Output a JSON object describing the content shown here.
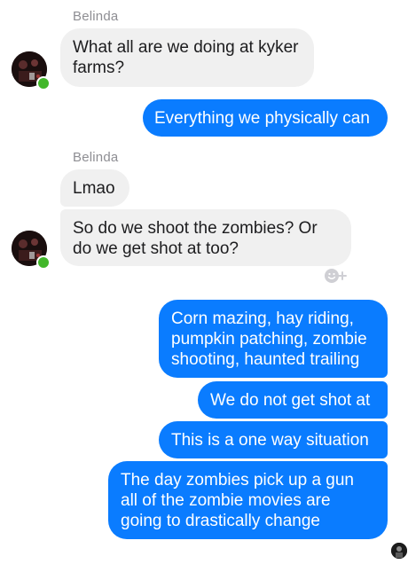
{
  "thread": {
    "groups": [
      {
        "sender": "Belinda",
        "messages": [
          "What all are we doing at kyker\nfarms?"
        ]
      },
      {
        "sender": "",
        "messages": [
          "Everything we physically can"
        ]
      },
      {
        "sender": "Belinda",
        "messages": [
          "Lmao",
          "So do we shoot the zombies? Or\ndo we get shot at too?"
        ]
      },
      {
        "sender": "",
        "messages": [
          "Corn mazing, hay riding,\npumpkin patching, zombie\nshooting, haunted trailing",
          "We do not get shot at",
          "This is a one way situation",
          "The day zombies pick up a gun\nall of the zombie movies are\ngoing to drastically change"
        ]
      }
    ]
  },
  "colors": {
    "outgoing_bubble": "#0a7cff",
    "incoming_bubble": "#f0f0f0",
    "online_indicator": "#42b72a",
    "sender_name": "#8e8e93"
  },
  "icons": {
    "reaction": "smiley-plus-icon",
    "presence": "online-dot-icon",
    "read_receipt": "read-receipt-avatar-icon"
  }
}
